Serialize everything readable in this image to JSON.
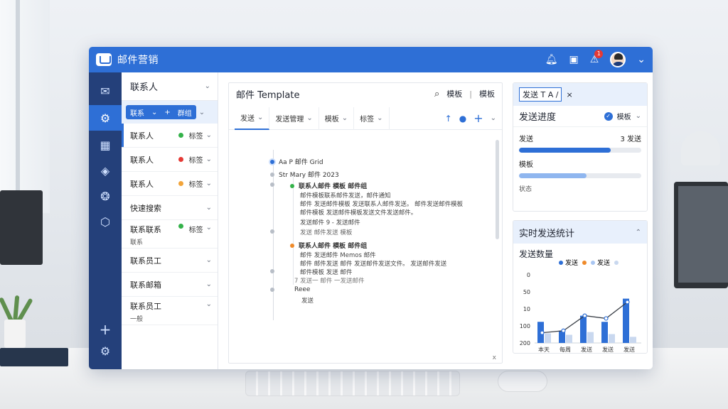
{
  "app": {
    "title": "邮件营销",
    "notification_count": "1"
  },
  "contacts": {
    "header": "联系人",
    "filter_labels": [
      "联系",
      "群组"
    ],
    "items": [
      {
        "name": "联系人",
        "tag": "标签",
        "dot": "#34b24a",
        "selected": true
      },
      {
        "name": "联系人",
        "tag": "标签",
        "dot": "#e53935",
        "selected": false
      },
      {
        "name": "联系人",
        "tag": "标签",
        "dot": "#f2a43a",
        "selected": false
      },
      {
        "name": "快速搜索",
        "tag": "",
        "dot": "",
        "selected": false
      },
      {
        "name": "联系联系",
        "sub": "联系",
        "tag": "标签",
        "dot": "#34b24a",
        "selected": false
      },
      {
        "name": "联系员工",
        "sub": "",
        "tag": "",
        "dot": "",
        "selected": false
      },
      {
        "name": "联系邮箱",
        "sub": "",
        "tag": "",
        "dot": "",
        "selected": false
      },
      {
        "name": "联系员工",
        "sub": "一般",
        "tag": "",
        "dot": "",
        "selected": false
      }
    ]
  },
  "editor": {
    "title": "邮件 Template",
    "head_extra": "模板",
    "tabs": [
      "发送",
      "发送管理",
      "模板",
      "标签"
    ],
    "tree": {
      "root": "Aa P 邮件 Grid",
      "level1": "Str Mary 邮件 2023",
      "node_a_title": "联系人邮件 模板 邮件组",
      "node_a_lines": [
        "邮件模板联系邮件发送，邮件通知",
        "邮件 发送邮件模板 发送联系人邮件发送。 邮件发送邮件模板",
        "邮件模板 发送邮件模板发送文件发送邮件。",
        "发送邮件 9 - 发送邮件"
      ],
      "node_a_foot": "发送 邮件发送 模板",
      "node_b_title": "联系人邮件 模板 邮件组",
      "node_b_lines": [
        "邮件 发送邮件 Memos 邮件",
        "邮件 邮件发送 邮件 发送邮件发送文件。 发送邮件发送",
        "邮件模板 发送 邮件"
      ],
      "node_b_foot": "7 发送一 邮件 一发送邮件",
      "node_c": "Reee",
      "node_d": "发送"
    },
    "footer": "x"
  },
  "stats": {
    "input_value": "发送 T A /",
    "panel_title": "发送进度",
    "panel_filter": "模板",
    "metrics": [
      {
        "label": "发送",
        "value": "3 发送",
        "fill": 0.75,
        "color": "#2e6fd6"
      },
      {
        "label": "模板",
        "value": "",
        "fill": 0.55,
        "color": "#8fb6ef"
      }
    ],
    "status_label": "状态"
  },
  "realtime": {
    "header": "实时发送统计",
    "chart_title": "发送数量",
    "legend": [
      {
        "label": "发送",
        "color": "#2e6fd6"
      },
      {
        "label": "发送",
        "color": "#ef8a2a"
      },
      {
        "label": "发送",
        "color": "#a9c6f2"
      }
    ]
  },
  "chart_data": {
    "type": "bar",
    "categories": [
      "本天",
      "每周",
      "发送",
      "发送",
      "发送"
    ],
    "series": [
      {
        "values": [
          62,
          36,
          80,
          62,
          130
        ]
      },
      {
        "values": [
          28,
          24,
          32,
          26,
          18
        ]
      },
      {
        "values": [
          30,
          36,
          80,
          72,
          120
        ]
      }
    ],
    "ylim": [
      0,
      200
    ],
    "yticks": [
      "0",
      "50",
      "10",
      "100",
      "200"
    ]
  },
  "icons": {
    "bell": "bell-icon",
    "chat": "chat-icon",
    "alert": "alert-icon",
    "rail": [
      "inbox-icon",
      "settings-icon",
      "calendar-icon",
      "box-icon",
      "gear-icon",
      "mail-icon",
      "plus-icon",
      "settings-bottom-icon"
    ]
  },
  "colors": {
    "primary": "#2e6fd6",
    "rail": "#24407a"
  }
}
